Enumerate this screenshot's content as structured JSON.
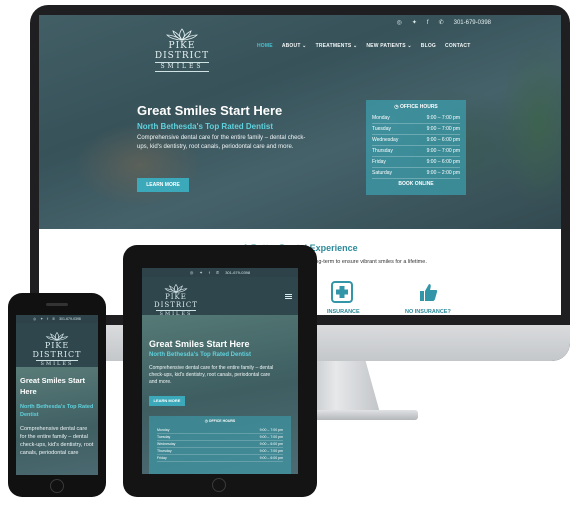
{
  "site": {
    "logo_name": "PIKE DISTRICT",
    "logo_sub": "SMILES",
    "phone": "301-679-0398"
  },
  "nav": {
    "items": [
      "HOME",
      "ABOUT ⌄",
      "TREATMENTS ⌄",
      "NEW PATIENTS ⌄",
      "BLOG",
      "CONTACT"
    ]
  },
  "hero": {
    "title": "Great Smiles Start Here",
    "subtitle": "North Bethesda's Top Rated Dentist",
    "body": "Comprehensive dental care for the entire family – dental check-ups, kid's dentistry, root canals, periodontal care and more.",
    "button": "LEARN MORE"
  },
  "hours": {
    "title": "OFFICE HOURS",
    "rows": [
      {
        "day": "Monday",
        "time": "9:00 – 7:00 pm"
      },
      {
        "day": "Tuesday",
        "time": "9:00 – 7:00 pm"
      },
      {
        "day": "Wednesday",
        "time": "9:00 – 6:00 pm"
      },
      {
        "day": "Thursday",
        "time": "9:00 – 7:00 pm"
      },
      {
        "day": "Friday",
        "time": "9:00 – 6:00 pm"
      },
      {
        "day": "Saturday",
        "time": "9:00 – 2:00 pm"
      }
    ],
    "book": "BOOK ONLINE"
  },
  "section": {
    "title": "A Better Dental Experience",
    "text": "long-term to ensure vibrant smiles for a lifetime.",
    "features": [
      "INSURANCE",
      "NO INSURANCE?"
    ]
  },
  "tablet": {
    "phone": "301-679-0398",
    "hero_subtitle": "North Bethesda's Top Rated Dentist",
    "hours_rows": [
      {
        "day": "Monday",
        "time": "9:00 – 7:00 pm"
      },
      {
        "day": "Tuesday",
        "time": "9:00 – 7:00 pm"
      },
      {
        "day": "Wednesday",
        "time": "9:00 – 6:00 pm"
      },
      {
        "day": "Thursday",
        "time": "9:00 – 7:00 pm"
      },
      {
        "day": "Friday",
        "time": "9:00 – 6:00 pm"
      }
    ]
  },
  "phone_device": {
    "phone": "301-679-0398",
    "hero_title": "Great Smiles Start Here",
    "hero_subtitle": "North Bethesda's Top Rated Dentist",
    "hero_body": "Comprehensive dental care for the entire family – dental check-ups, kid's dentistry, root canals, periodontal care"
  },
  "colors": {
    "accent": "#3ba9ba",
    "accent_text": "#5fd2de",
    "heading_teal": "#2b8a9a",
    "dark_header": "#2f464d"
  },
  "icons": {
    "social": [
      "instagram-icon",
      "twitter-icon",
      "facebook-icon",
      "phone-icon"
    ],
    "features": [
      "medical-kit-icon",
      "thumbs-up-icon"
    ]
  }
}
